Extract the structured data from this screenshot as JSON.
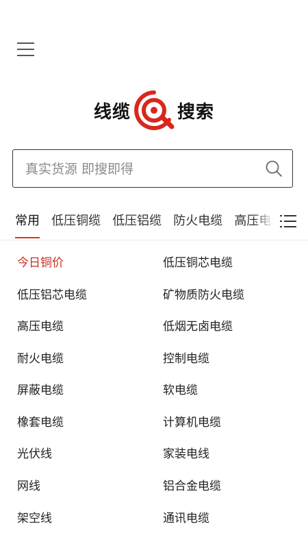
{
  "header": {
    "menu_icon": "hamburger-menu-icon",
    "logo": {
      "left_text": "线缆",
      "right_text": "搜索",
      "accent_color": "#d9271d"
    }
  },
  "search": {
    "placeholder": "真实货源 即搜即得",
    "value": "",
    "icon": "search-icon"
  },
  "tabs": {
    "items": [
      "常用",
      "低压铜缆",
      "低压铝缆",
      "防火电缆",
      "高压电缆"
    ],
    "active_index": 0,
    "accent_color": "#e0301e",
    "more_icon": "list-icon"
  },
  "categories": {
    "left": [
      "今日铜价",
      "低压铝芯电缆",
      "高压电缆",
      "耐火电缆",
      "屏蔽电缆",
      "橡套电缆",
      "光伏线",
      "网线",
      "架空线"
    ],
    "right": [
      "低压铜芯电缆",
      "矿物质防火电缆",
      "低烟无卤电缆",
      "控制电缆",
      "软电缆",
      "计算机电缆",
      "家装电线",
      "铝合金电缆",
      "通讯电缆"
    ],
    "highlight_color": "#c8301e"
  }
}
